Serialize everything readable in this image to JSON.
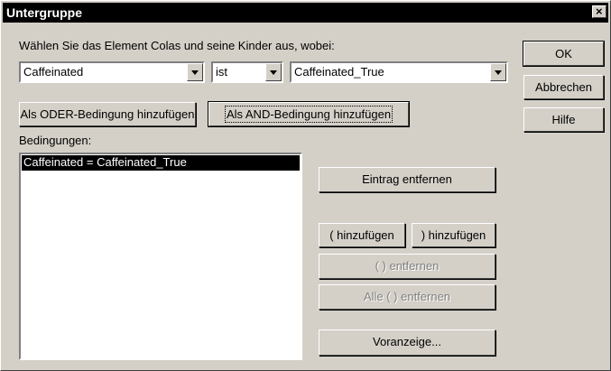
{
  "window": {
    "title": "Untergruppe",
    "close_symbol": "×"
  },
  "instruction": "Wählen Sie das Element Colas und seine Kinder aus, wobei:",
  "filters": {
    "field": "Caffeinated",
    "operator": "ist",
    "value": "Caffeinated_True"
  },
  "buttons": {
    "ok": "OK",
    "cancel": "Abbrechen",
    "help": "Hilfe",
    "add_or": "Als ODER-Bedingung hinzufügen",
    "add_and": "Als AND-Bedingung hinzufügen",
    "remove_entry": "Eintrag entfernen",
    "add_open_paren": "( hinzufügen",
    "add_close_paren": ") hinzufügen",
    "remove_parens": "(  ) entfernen",
    "remove_all_parens": "Alle (  ) entfernen",
    "preview": "Voranzeige..."
  },
  "conditions_label": "Bedingungen:",
  "conditions": [
    "Caffeinated = Caffeinated_True"
  ]
}
